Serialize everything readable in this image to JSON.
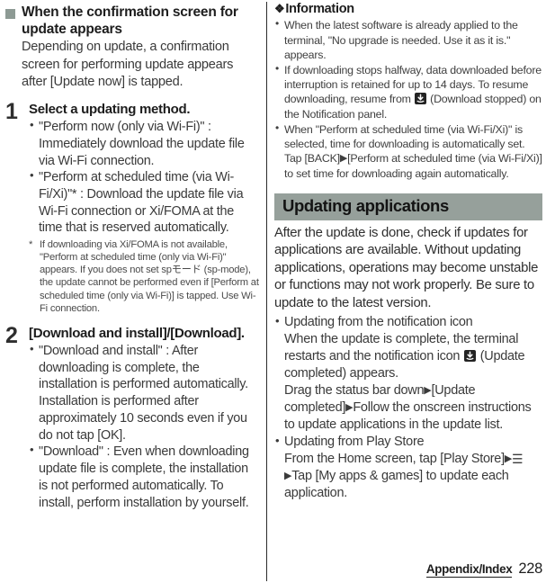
{
  "left_column": {
    "section_heading": "When the confirmation screen for update appears",
    "section_intro": "Depending on update, a confirmation screen for performing update appears after [Update now] is tapped.",
    "steps": [
      {
        "number": "1",
        "title": "Select a updating method.",
        "bullets": [
          "\"Perform now (only via Wi-Fi)\" : Immediately download the update file via Wi-Fi connection.",
          "\"Perform at scheduled time (via Wi-Fi/Xi)\"* : Download the update file via Wi-Fi connection or Xi/FOMA at the time that is reserved automatically."
        ],
        "footnote_marker": "*",
        "footnote": "If downloading via Xi/FOMA is not available, \"Perform at scheduled time (only via Wi-Fi)\" appears. If you does not set spモード (sp-mode), the update cannot be performed even if [Perform at scheduled time (only via Wi-Fi)] is tapped. Use Wi-Fi connection."
      },
      {
        "number": "2",
        "title": "[Download and install]/[Download].",
        "bullets": [
          "\"Download and install\" : After downloading is complete, the installation is performed automatically. Installation is performed after approximately 10 seconds even if you do not tap [OK].",
          "\"Download\" : Even when downloading update file is complete, the installation is not performed automatically. To install, perform installation by yourself."
        ]
      }
    ]
  },
  "right_column": {
    "information": {
      "heading": "Information",
      "diamond": "❖",
      "items": [
        {
          "parts": [
            {
              "type": "text",
              "value": "When the latest software is already applied to the terminal, \"No upgrade is needed. Use it as it is.\" appears."
            }
          ]
        },
        {
          "parts": [
            {
              "type": "text",
              "value": "If downloading stops halfway, data downloaded before interruption is retained for up to 14 days. To resume downloading, resume from "
            },
            {
              "type": "icon",
              "value": "download-stopped-icon"
            },
            {
              "type": "text",
              "value": " (Download stopped) on the Notification panel."
            }
          ]
        },
        {
          "parts": [
            {
              "type": "text",
              "value": "When \"Perform at scheduled time (via Wi-Fi/Xi)\" is selected, time for downloading is automatically set. Tap [BACK]"
            },
            {
              "type": "arrow",
              "value": "▶"
            },
            {
              "type": "text",
              "value": "[Perform at scheduled time (via Wi-Fi/Xi)] to set time for downloading again automatically."
            }
          ]
        }
      ]
    },
    "section_bar_title": "Updating applications",
    "section_intro": "After the update is done, check if updates for applications are available. Without updating applications, operations may become unstable or functions may not work properly. Be sure to update to the latest version.",
    "bullets": [
      {
        "heading": "Updating from the notification icon",
        "lines": [
          {
            "parts": [
              {
                "type": "text",
                "value": "When the update is complete, the terminal restarts and the notification icon "
              },
              {
                "type": "icon",
                "value": "update-completed-icon"
              },
              {
                "type": "text",
                "value": " (Update completed) appears."
              }
            ]
          },
          {
            "parts": [
              {
                "type": "text",
                "value": "Drag the status bar down"
              },
              {
                "type": "arrow",
                "value": "▶"
              },
              {
                "type": "text",
                "value": "[Update completed]"
              },
              {
                "type": "arrow",
                "value": "▶"
              },
              {
                "type": "text",
                "value": "Follow the onscreen instructions to update applications in the update list."
              }
            ]
          }
        ]
      },
      {
        "heading": "Updating from Play Store",
        "lines": [
          {
            "parts": [
              {
                "type": "text",
                "value": "From the Home screen, tap [Play Store]"
              },
              {
                "type": "arrow",
                "value": "▶"
              },
              {
                "type": "menu",
                "value": "☰"
              },
              {
                "type": "arrow",
                "value": "▶"
              },
              {
                "type": "text",
                "value": "Tap [My apps & games] to update each application."
              }
            ]
          }
        ]
      }
    ]
  },
  "footer": {
    "label": "Appendix/Index",
    "page_number": "228"
  },
  "colors": {
    "section_bar": "#96a09b",
    "marker": "#8d9a94",
    "text": "#3a3a3a",
    "heading": "#1d1d1d"
  }
}
